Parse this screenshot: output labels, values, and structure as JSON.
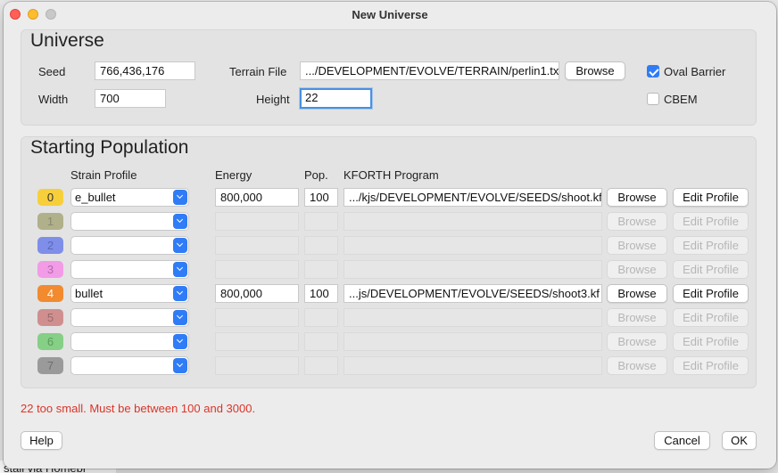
{
  "background": {
    "text": "stall via Homebr"
  },
  "window": {
    "title": "New Universe"
  },
  "universe": {
    "title": "Universe",
    "seed_label": "Seed",
    "seed_value": "766,436,176",
    "width_label": "Width",
    "width_value": "700",
    "terrain_label": "Terrain File",
    "terrain_value": ".../DEVELOPMENT/EVOLVE/TERRAIN/perlin1.txt",
    "height_label": "Height",
    "height_value": "22",
    "browse_label": "Browse",
    "oval_barrier_label": "Oval Barrier",
    "oval_barrier_checked": true,
    "cbem_label": "CBEM",
    "cbem_checked": false
  },
  "population": {
    "title": "Starting Population",
    "headers": {
      "strain": "Strain Profile",
      "energy": "Energy",
      "pop": "Pop.",
      "kforth": "KFORTH Program"
    },
    "browse_label": "Browse",
    "edit_label": "Edit Profile",
    "rows": [
      {
        "num": "0",
        "color": "#f7cf3b",
        "text_color": "#333333",
        "strain": "e_bullet",
        "energy": "800,000",
        "pop": "100",
        "program": ".../kjs/DEVELOPMENT/EVOLVE/SEEDS/shoot.kf",
        "enabled": true
      },
      {
        "num": "1",
        "color": "#b0b08a",
        "text_color": "#8a8a70",
        "strain": "",
        "energy": "",
        "pop": "",
        "program": "",
        "enabled": false
      },
      {
        "num": "2",
        "color": "#7f8ee8",
        "text_color": "#5b68b8",
        "strain": "",
        "energy": "",
        "pop": "",
        "program": "",
        "enabled": false
      },
      {
        "num": "3",
        "color": "#f29be6",
        "text_color": "#b46aac",
        "strain": "",
        "energy": "",
        "pop": "",
        "program": "",
        "enabled": false
      },
      {
        "num": "4",
        "color": "#f28a30",
        "text_color": "#ffffff",
        "strain": "bullet",
        "energy": "800,000",
        "pop": "100",
        "program": "...js/DEVELOPMENT/EVOLVE/SEEDS/shoot3.kf",
        "enabled": true
      },
      {
        "num": "5",
        "color": "#cf8f8f",
        "text_color": "#9a6a6a",
        "strain": "",
        "energy": "",
        "pop": "",
        "program": "",
        "enabled": false
      },
      {
        "num": "6",
        "color": "#86cf86",
        "text_color": "#5c9c5c",
        "strain": "",
        "energy": "",
        "pop": "",
        "program": "",
        "enabled": false
      },
      {
        "num": "7",
        "color": "#9a9a9a",
        "text_color": "#6e6e6e",
        "strain": "",
        "energy": "",
        "pop": "",
        "program": "",
        "enabled": false
      }
    ]
  },
  "error_message": "22 too small. Must be between 100 and 3000.",
  "footer": {
    "help": "Help",
    "cancel": "Cancel",
    "ok": "OK"
  }
}
